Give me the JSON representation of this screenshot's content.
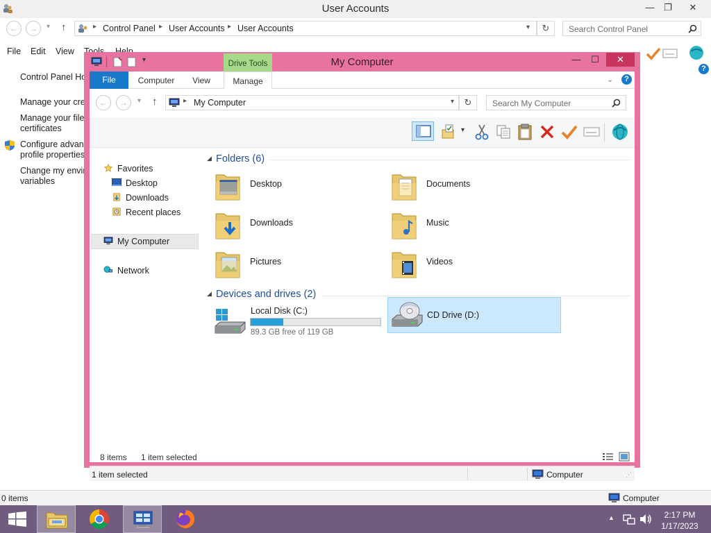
{
  "background_window": {
    "title": "User Accounts",
    "controls": {
      "minimize": "—",
      "restore": "❐",
      "close": "✕"
    },
    "nav": {
      "back": "←",
      "forward": "→",
      "dropdown": "▾",
      "up": "↑"
    },
    "breadcrumb": [
      "Control Panel",
      "User Accounts",
      "User Accounts"
    ],
    "refresh": "↻",
    "search_placeholder": "Search Control Panel",
    "menu": [
      "File",
      "Edit",
      "View",
      "Tools",
      "Help"
    ],
    "left_links": [
      "Control Panel Home",
      "Manage your credentials",
      "Manage your file encryption",
      "certificates",
      "Configure advanced user",
      "profile properties",
      "Change my environment",
      "variables"
    ],
    "status": {
      "items": "0 items",
      "location": "Computer"
    }
  },
  "window": {
    "title": "My Computer",
    "contextual_tab": "Drive Tools",
    "controls": {
      "minimize": "—",
      "maximize": "☐",
      "close": "✕"
    },
    "ribbon_tabs": [
      "File",
      "Computer",
      "View",
      "Manage"
    ],
    "help": "?",
    "address": "My Computer",
    "search_placeholder": "Search My Computer",
    "nav": {
      "back": "←",
      "forward": "→",
      "dropdown": "▾",
      "up": "↑",
      "refresh": "↻"
    },
    "toolbar_icons": [
      "details-pane-icon",
      "folder-properties-icon",
      "cut-icon",
      "copy-icon",
      "paste-icon",
      "delete-icon",
      "checkmark-icon",
      "rename-icon",
      "globe-icon"
    ]
  },
  "nav_pane": {
    "favorites": "Favorites",
    "favorite_items": [
      "Desktop",
      "Downloads",
      "Recent places"
    ],
    "my_computer": "My Computer",
    "network": "Network"
  },
  "content": {
    "folders_header": "Folders (6)",
    "folders": [
      {
        "name": "Desktop",
        "icon": "desktop-folder-icon"
      },
      {
        "name": "Documents",
        "icon": "documents-folder-icon"
      },
      {
        "name": "Downloads",
        "icon": "downloads-folder-icon"
      },
      {
        "name": "Music",
        "icon": "music-folder-icon"
      },
      {
        "name": "Pictures",
        "icon": "pictures-folder-icon"
      },
      {
        "name": "Videos",
        "icon": "videos-folder-icon"
      }
    ],
    "drives_header": "Devices and drives (2)",
    "drives": [
      {
        "name": "Local Disk (C:)",
        "free": "89.3 GB free of 119 GB",
        "used_fraction": 0.25
      },
      {
        "name": "CD Drive (D:)"
      }
    ]
  },
  "status": {
    "items": "8 items",
    "selected": "1 item selected",
    "bottom_selected": "1 item selected",
    "location": "Computer"
  },
  "taskbar": {
    "time": "2:17 PM",
    "date": "1/17/2023",
    "tray_arrow": "▲"
  },
  "colors": {
    "window_frame": "#e872a0",
    "close_button": "#c7345d",
    "file_tab": "#1979ca",
    "drive_tools": "#a6d98a",
    "group_header": "#1f4e9c",
    "taskbar": "#6f5c7f",
    "progress": "#26a0da"
  }
}
